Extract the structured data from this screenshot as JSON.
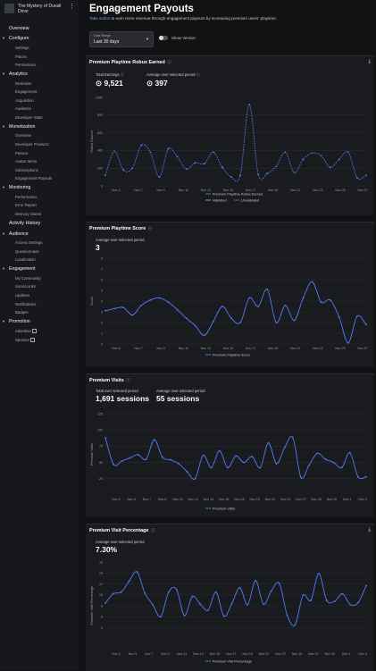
{
  "sidebar": {
    "game_title": "The Mystery of Duvall Drive",
    "overview": "Overview",
    "activity_history": "Activity History",
    "sections": [
      {
        "key": "configure",
        "label": "Configure",
        "items": [
          "Settings",
          "Places",
          "Permissions"
        ]
      },
      {
        "key": "analytics",
        "label": "Analytics",
        "items": [
          "Retention",
          "Engagement",
          "Acquisition",
          "Audience",
          "Developer Stats"
        ]
      },
      {
        "key": "monetization",
        "label": "Monetization",
        "items": [
          "Overview",
          "Developer Products",
          "Passes",
          "Avatar Items",
          "Subscriptions",
          "Engagement Payouts"
        ]
      },
      {
        "key": "monitoring",
        "label": "Monitoring",
        "items": [
          "Performance",
          "Error Report",
          "Memory Stores"
        ]
      },
      {
        "key": "audience",
        "label": "Audience",
        "items": [
          "Access Settings",
          "Questionnaire",
          "Localization"
        ]
      },
      {
        "key": "engagement",
        "label": "Engagement",
        "items": [
          "My Community",
          "Social Links",
          "Updates",
          "Notifications",
          "Badges"
        ]
      },
      {
        "key": "promotion",
        "label": "Promotion",
        "items": [
          "Advertise",
          "Sponsor"
        ]
      }
    ]
  },
  "header": {
    "title": "Engagement Payouts",
    "subtitle_link": "Take action",
    "subtitle_rest": " to earn more revenue through engagement payouts by increasing premium users' playtime.",
    "date_range_label": "Date Range",
    "date_range_value": "Last 30 days",
    "toggle_label": "Show Version"
  },
  "colors": {
    "accent": "#4f7cf7",
    "grid": "#2c2d31",
    "bg": "#1a1b1e"
  },
  "panels": {
    "robux": {
      "title": "Premium Playtime Robux Earned",
      "total_label": "Total Earnings",
      "total_value": "9,521",
      "avg_label": "Average over selected period",
      "avg_value": "397",
      "legend_series": "Premium Playtime Robux Earned",
      "legend_validated": "Validated",
      "legend_unvalidated": "Unvalidated"
    },
    "score": {
      "title": "Premium Playtime Score",
      "avg_label": "Average over selected period",
      "avg_value": "3",
      "legend_series": "Premium Playtime Score"
    },
    "visits": {
      "title": "Premium Visits",
      "total_label": "Total over selected period",
      "total_value": "1,691 sessions",
      "avg_label": "Average over selected period",
      "avg_value": "55 sessions",
      "legend_series": "Premium Visits"
    },
    "pct": {
      "title": "Premium Visit Percentage",
      "avg_label": "Average over selected period",
      "avg_value": "7.30%",
      "legend_series": "Premium Visit Percentage"
    }
  },
  "chart_data": [
    {
      "id": "robux",
      "type": "line",
      "ylabel": "Robux Earned",
      "ylim": [
        0,
        1000
      ],
      "yticks": [
        0,
        200,
        400,
        600,
        800,
        1000
      ],
      "xticks": [
        "Nov 3",
        "Nov 7",
        "Nov 9",
        "Nov 11",
        "Nov 13",
        "Nov 15",
        "Nov 17",
        "Nov 19",
        "Nov 21",
        "Nov 23",
        "Nov 26",
        "Nov 27"
      ],
      "values": [
        120,
        390,
        180,
        200,
        460,
        380,
        100,
        420,
        330,
        190,
        260,
        250,
        380,
        210,
        100,
        120,
        920,
        130,
        140,
        220,
        380,
        150,
        300,
        370,
        340,
        210,
        300,
        380,
        90,
        120
      ]
    },
    {
      "id": "score",
      "type": "line",
      "ylabel": "Score",
      "ylim": [
        0,
        8
      ],
      "yticks": [
        0,
        1,
        2,
        3,
        4,
        5,
        6,
        7,
        8
      ],
      "xticks": [
        "Nov 5",
        "Nov 7",
        "Nov 9",
        "Nov 11",
        "Nov 13",
        "Nov 15",
        "Nov 17",
        "Nov 19",
        "Nov 21",
        "Nov 23",
        "Nov 25",
        "Nov 27"
      ],
      "values": [
        3.1,
        3.3,
        3.4,
        2.7,
        3.6,
        4.1,
        4.3,
        3.9,
        3.2,
        2.4,
        1.7,
        0.8,
        2.1,
        3.5,
        2.4,
        2.0,
        4.3,
        3.5,
        5.1,
        2.0,
        3.6,
        2.2,
        4.3,
        5.8,
        3.9,
        4.1,
        2.5,
        0.1,
        2.6,
        1.8
      ]
    },
    {
      "id": "visits",
      "type": "line",
      "ylabel": "Premium Visits",
      "ylim": [
        0,
        125
      ],
      "yticks": [
        25,
        50,
        75,
        100,
        125
      ],
      "xticks": [
        "Nov 4",
        "Nov 5",
        "Nov 7",
        "Nov 8",
        "Nov 10",
        "Nov 12",
        "Nov 14",
        "Nov 16",
        "Nov 18",
        "Nov 19",
        "Nov 22",
        "Nov 24",
        "Nov 27",
        "Nov 28",
        "Nov 30",
        "Dec 1",
        "Dec 3"
      ],
      "values": [
        88,
        47,
        52,
        57,
        62,
        55,
        85,
        58,
        54,
        48,
        36,
        25,
        61,
        42,
        68,
        42,
        60,
        50,
        59,
        42,
        80,
        48,
        73,
        88,
        27,
        46,
        64,
        55,
        50,
        42,
        65,
        28,
        28
      ]
    },
    {
      "id": "pct",
      "type": "line",
      "ylabel": "Premium Visit Percentage",
      "ylim": [
        0,
        16
      ],
      "yticks": [
        4,
        6,
        8,
        10,
        12,
        14,
        16
      ],
      "xticks": [
        "Nov 3",
        "Nov 5",
        "Nov 7",
        "Nov 9",
        "Nov 11",
        "Nov 13",
        "Nov 15",
        "Nov 17",
        "Nov 19",
        "Nov 21",
        "Nov 23",
        "Nov 25",
        "Nov 27",
        "Nov 29",
        "Dec 1",
        "Dec 3"
      ],
      "values": [
        8.5,
        10.2,
        10.5,
        12.5,
        14.2,
        10.3,
        8.2,
        6.0,
        10.5,
        11.0,
        6.2,
        9.7,
        8.3,
        7.2,
        10.5,
        6.1,
        8.4,
        11.3,
        8.2,
        12.6,
        8.3,
        10.7,
        12.1,
        6.3,
        4.5,
        9.9,
        9.0,
        13.9,
        9.0,
        8.8,
        10.2,
        8.2,
        8.6,
        11.7
      ]
    }
  ]
}
